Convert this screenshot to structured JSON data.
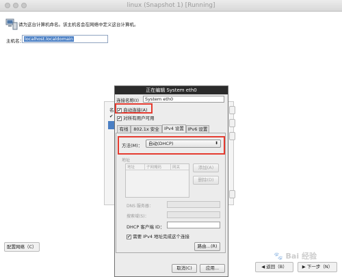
{
  "window": {
    "title": "linux (Snapshot 1) [Running]"
  },
  "installer": {
    "prompt": "请为这台计算机命名。该主机名会在网络中定义这台计算机。",
    "hostname_label": "主机名：",
    "hostname_value": "localhost.localdomain",
    "configure_network_button": "配置网络（C）",
    "back_button": "返回（B）",
    "next_button": "下一步（N）",
    "left_letter": "名",
    "left_check": "✔"
  },
  "dialog": {
    "title": "正在编辑 System eth0",
    "connection_name_label": "连接名称(I)",
    "connection_name_value": "System eth0",
    "auto_connect_label": "自动连接(A)",
    "all_users_label": "对所有用户可用",
    "tabs": [
      {
        "label": "有线"
      },
      {
        "label": "802.1x 安全性"
      },
      {
        "label": "IPv4 设置"
      },
      {
        "label": "IPv6 设置"
      }
    ],
    "method_label": "方法(M)：",
    "method_value": "自动(DHCP)",
    "address_section": "地址",
    "columns": [
      "地址",
      "子网掩码",
      "网关"
    ],
    "add_button": "添加(A)",
    "delete_button": "删除(D)",
    "dns_label": "DNS 服务器：",
    "search_domain_label": "搜索域(S)：",
    "dhcp_client_label": "DHCP 客户端 ID：",
    "require_ipv4_label": "需要 IPv4 地址完成这个连接",
    "route_button": "路由…(R)",
    "cancel_button": "取消(C)",
    "apply_button": "应用..."
  },
  "watermark": {
    "text": "Bai 经验"
  },
  "colors": {
    "highlight_red": "#e53a2f",
    "selection_blue": "#4a7fc4",
    "dialog_title_bg": "#2b2b2b"
  }
}
